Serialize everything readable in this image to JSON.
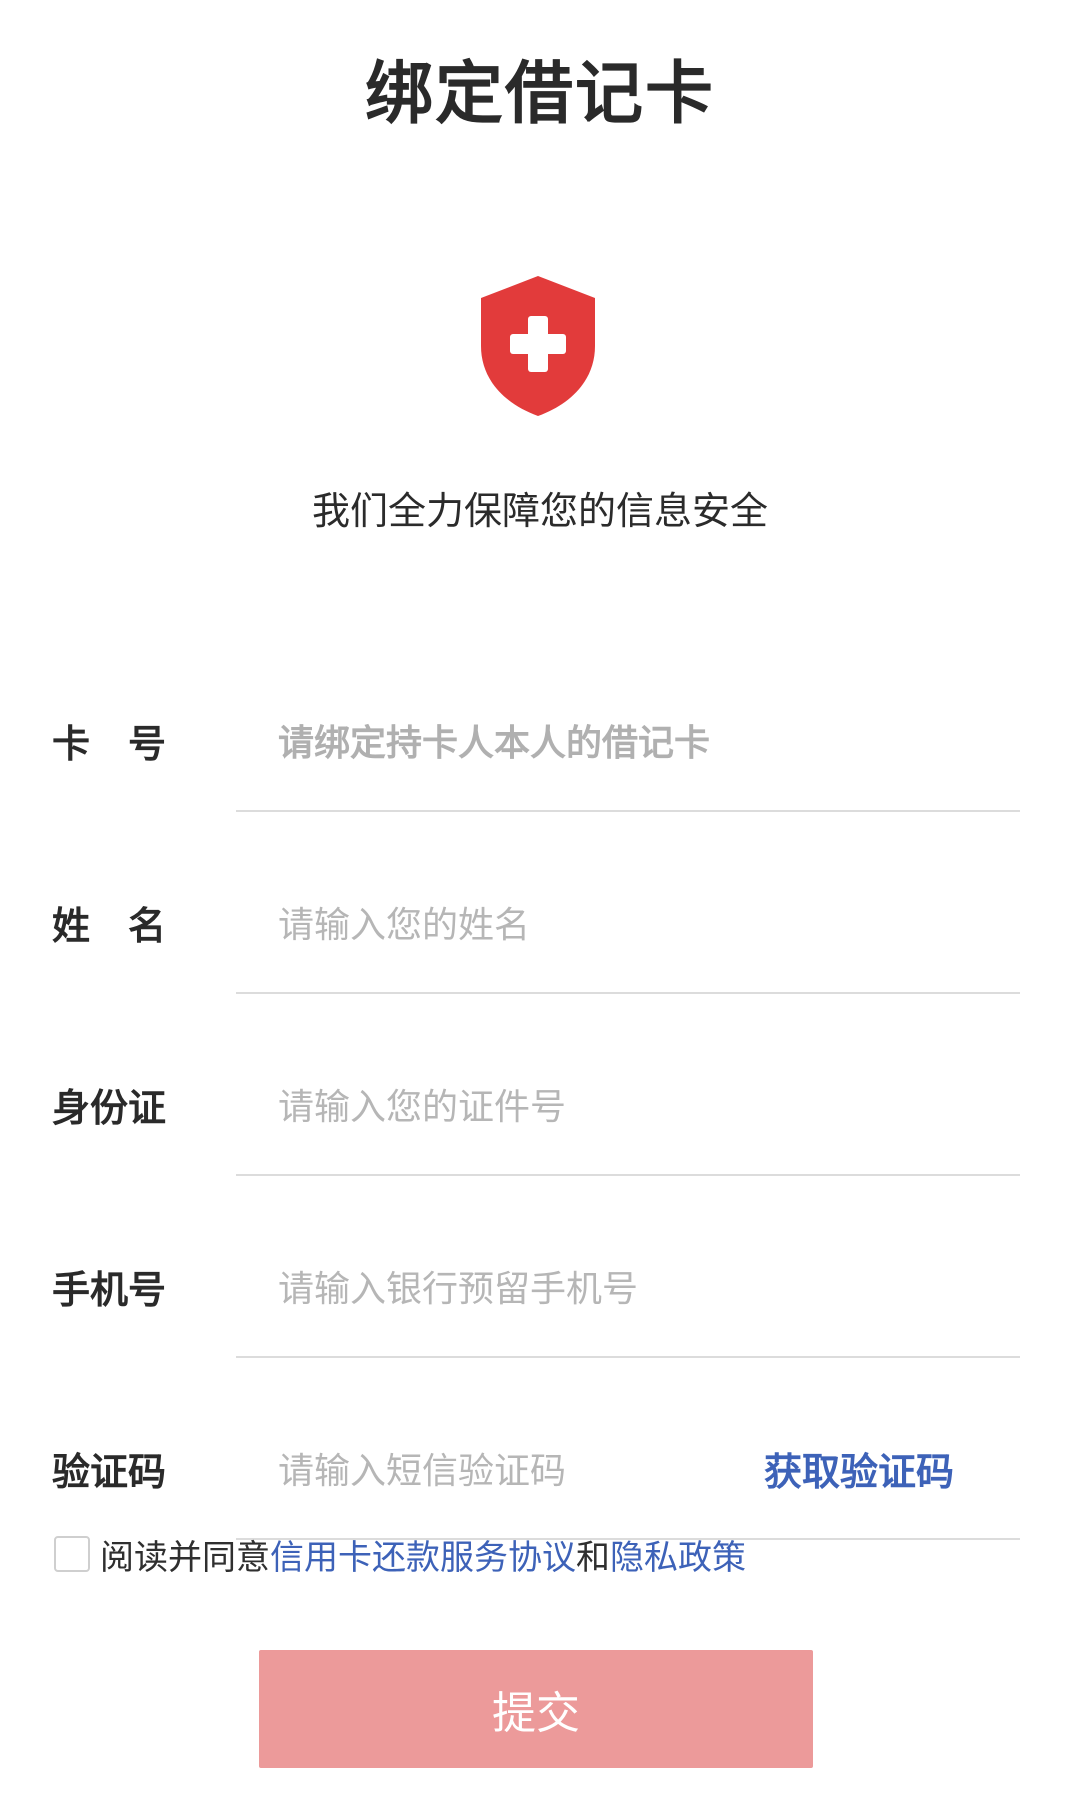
{
  "header": {
    "title": "绑定借记卡"
  },
  "security": {
    "icon": "shield-plus-icon",
    "text": "我们全力保障您的信息安全"
  },
  "form": {
    "card_number": {
      "label": "卡　号",
      "placeholder": "请绑定持卡人本人的借记卡",
      "value": ""
    },
    "name": {
      "label": "姓　名",
      "placeholder": "请输入您的姓名",
      "value": ""
    },
    "id_card": {
      "label": "身份证",
      "placeholder": "请输入您的证件号",
      "value": ""
    },
    "phone": {
      "label": "手机号",
      "placeholder": "请输入银行预留手机号",
      "value": ""
    },
    "sms_code": {
      "label": "验证码",
      "placeholder": "请输入短信验证码",
      "value": "",
      "get_code_label": "获取验证码"
    }
  },
  "agreement": {
    "checked": false,
    "prefix": "阅读并同意",
    "link1": "信用卡还款服务协议",
    "connector": "和",
    "link2": "隐私政策"
  },
  "submit": {
    "label": "提交"
  },
  "colors": {
    "shield_red": "#e23b3b",
    "link_blue": "#3d62b8",
    "submit_bg": "#ec9a9a"
  }
}
